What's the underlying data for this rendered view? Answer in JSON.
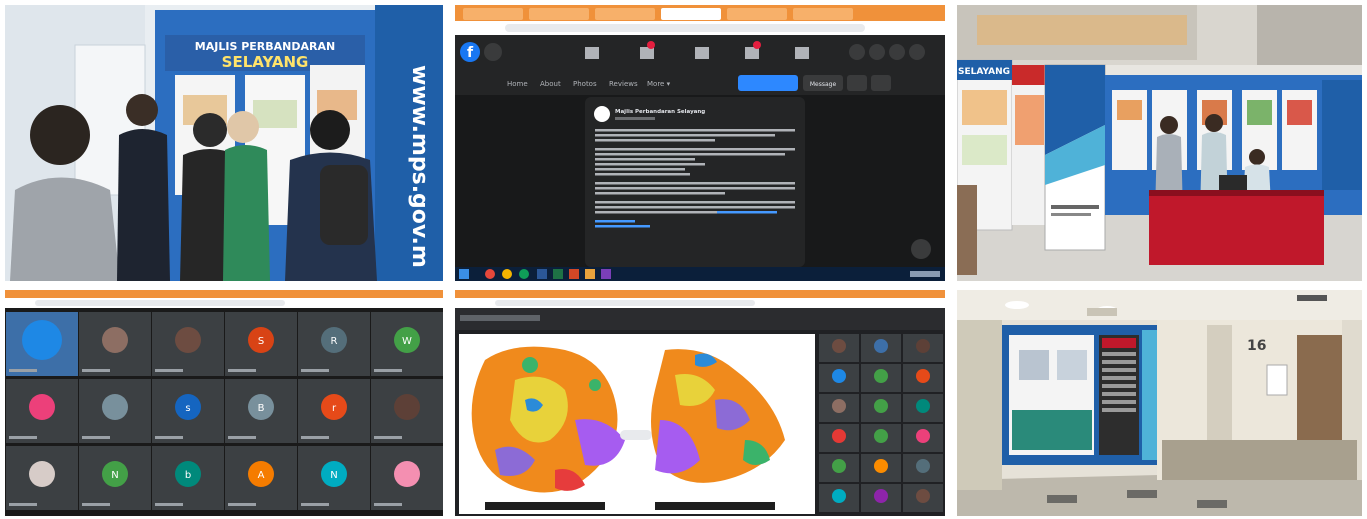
{
  "photo1": {
    "banner_line1": "MAJLIS PERBANDARAN",
    "banner_line2": "SELAYANG",
    "side_url": "www.mps.gov.m"
  },
  "photo2": {
    "facebook_glyph": "f",
    "nav_items": [
      "Home",
      "About",
      "Photos",
      "Reviews",
      "More ▾"
    ],
    "message_button": "Message",
    "post_author": "Majlis Perbandaran Selayang"
  },
  "photo3": {
    "panel_text": "SELAYANG"
  },
  "photo4": {
    "participant_initials": [
      "",
      "",
      "",
      "S",
      "R",
      "W",
      "",
      "",
      "s",
      "B",
      "r",
      "",
      "",
      "N",
      "b",
      "A",
      "N",
      ""
    ]
  },
  "photo5": {},
  "photo6": {
    "wall_number": "16"
  },
  "colors": {
    "mps_blue": "#1f5fa8",
    "facebook_blue": "#1877f2",
    "booth_red": "#c0182b",
    "meet_dark": "#202124",
    "map_orange": "#f08a1c",
    "map_purple": "#a65cf0"
  }
}
